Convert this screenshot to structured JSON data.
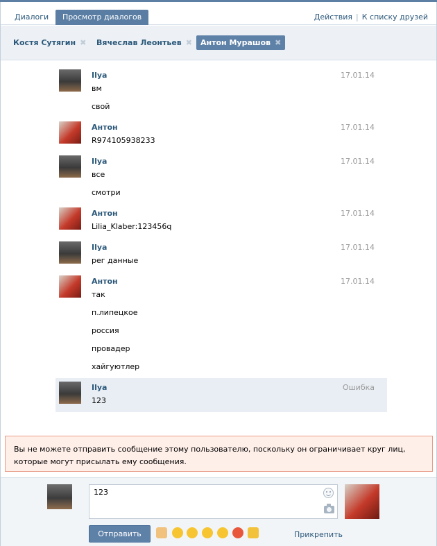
{
  "header": {
    "tab_dialogs": "Диалоги",
    "tab_view": "Просмотр диалогов",
    "action_actions": "Действия",
    "action_friends": "К списку друзей"
  },
  "chat_tabs": [
    {
      "label": "Костя Сутягин",
      "active": false
    },
    {
      "label": "Вячеслав Леонтьев",
      "active": false
    },
    {
      "label": "Антон Мурашов",
      "active": true
    }
  ],
  "messages": [
    {
      "author": "Ilya",
      "date": "17.01.14",
      "lines": [
        "вм",
        "свой"
      ]
    },
    {
      "author": "Антон",
      "date": "17.01.14",
      "lines": [
        "R974105938233"
      ]
    },
    {
      "author": "Ilya",
      "date": "17.01.14",
      "lines": [
        "все",
        "смотри"
      ]
    },
    {
      "author": "Антон",
      "date": "17.01.14",
      "lines": [
        "Lilia_Klaber:123456q"
      ]
    },
    {
      "author": "Ilya",
      "date": "17.01.14",
      "lines": [
        "рег данные"
      ]
    },
    {
      "author": "Антон",
      "date": "17.01.14",
      "lines": [
        "так",
        "п.липецкое",
        "россия",
        "провадер",
        "хайгуютлер"
      ]
    },
    {
      "author": "Ilya",
      "date": "Ошибка",
      "lines": [
        "123"
      ],
      "error": true
    }
  ],
  "notice": "Вы не можете отправить сообщение этому пользователю, поскольку он ограничивает круг лиц, которые могут присылать ему сообщения.",
  "compose": {
    "value": "123",
    "send_label": "Отправить",
    "attach_label": "Прикрепить"
  },
  "colors": {
    "accent": "#5e81a8",
    "link": "#2b587a",
    "error_bg": "#ffefe9",
    "error_border": "#e89b88"
  }
}
